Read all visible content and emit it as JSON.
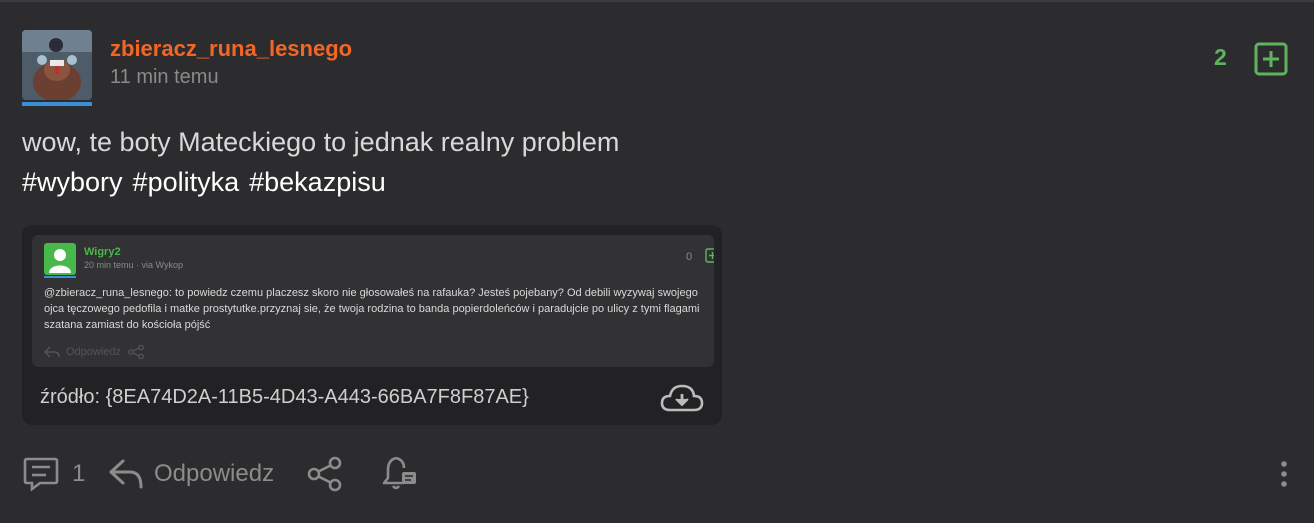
{
  "post": {
    "username": "zbieracz_runa_lesnego",
    "time": "11 min temu",
    "votes": "2",
    "text": "wow, te boty Mateckiego to jednak realny problem",
    "tags": [
      "#wybory",
      "#polityka",
      "#bekazpisu"
    ]
  },
  "embed": {
    "inner": {
      "username": "Wigry2",
      "time": "20 min temu · via Wykop",
      "votes": "0",
      "mention": "@zbieracz_runa_lesnego",
      "text": ": to powiedz czemu placzesz skoro nie głosowałeś na rafauka? Jesteś pojebany? Od debili wyzywaj swojego ojca tęczowego pedofila i matke prostytutke.przyznaj sie, że twoja rodzina to banda popierdoleńców i paradujcie po ulicy z tymi flagami szatana zamiast do kościoła pójść",
      "reply_label": "Odpowiedz"
    },
    "source": "źródło: {8EA74D2A-11B5-4D43-A443-66BA7F8F87AE}"
  },
  "footer": {
    "comments_count": "1",
    "reply_label": "Odpowiedz"
  },
  "colors": {
    "background": "#2c2c2e",
    "username": "#f26724",
    "vote_green": "#5fb35f",
    "inner_user_green": "#49b84a",
    "avatar_line_blue": "#3a8fd6"
  },
  "icons": {
    "plus": "plus-square-icon",
    "comments": "comments-icon",
    "reply": "reply-arrow-icon",
    "share": "share-icon",
    "notify": "bell-icon",
    "more": "more-vertical-icon",
    "download": "cloud-download-icon"
  }
}
